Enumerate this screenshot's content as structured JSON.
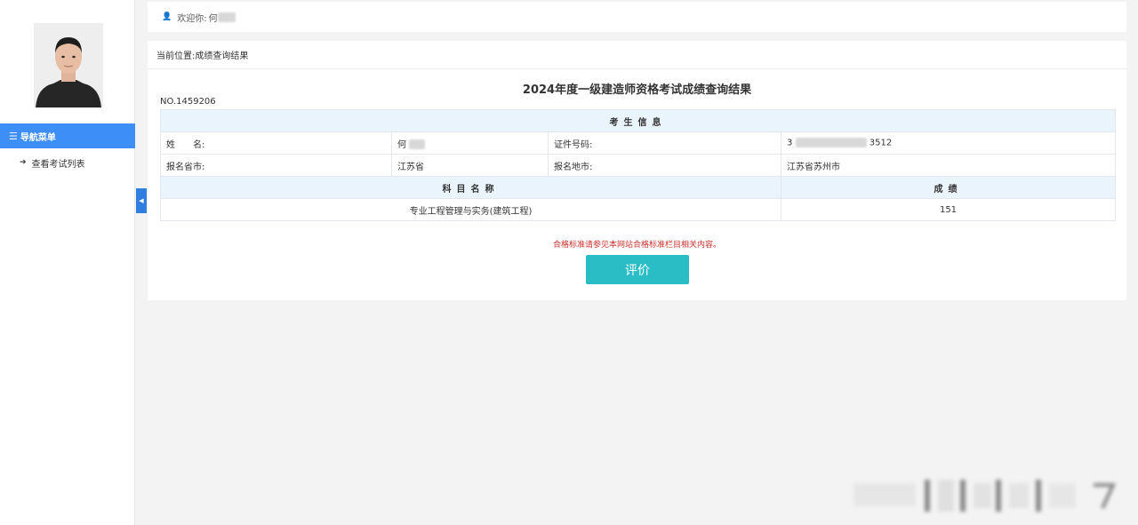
{
  "header": {
    "welcome": "欢迎你:",
    "user_name": "何"
  },
  "sidebar": {
    "nav_title": "导航菜单",
    "items": [
      {
        "label": "查看考试列表"
      }
    ]
  },
  "breadcrumb": {
    "prefix": "当前位置:",
    "current": "成绩查询结果"
  },
  "result": {
    "title": "2024年度一级建造师资格考试成绩查询结果",
    "serial": "NO.1459206",
    "section_header": "考生信息",
    "labels": {
      "name": "姓　　名:",
      "id_number": "证件号码:",
      "province": "报名省市:",
      "city": "报名地市:"
    },
    "values": {
      "name": "何",
      "id_prefix": "3",
      "id_suffix": "3512",
      "province": "江苏省",
      "city": "江苏省苏州市"
    },
    "score_header": {
      "subject": "科目名称",
      "score": "成绩"
    },
    "scores": [
      {
        "subject": "专业工程管理与实务(建筑工程)",
        "score": "151"
      }
    ],
    "note": "合格标准请参见本网站合格标准栏目相关内容。",
    "evaluate_button": "评价"
  }
}
